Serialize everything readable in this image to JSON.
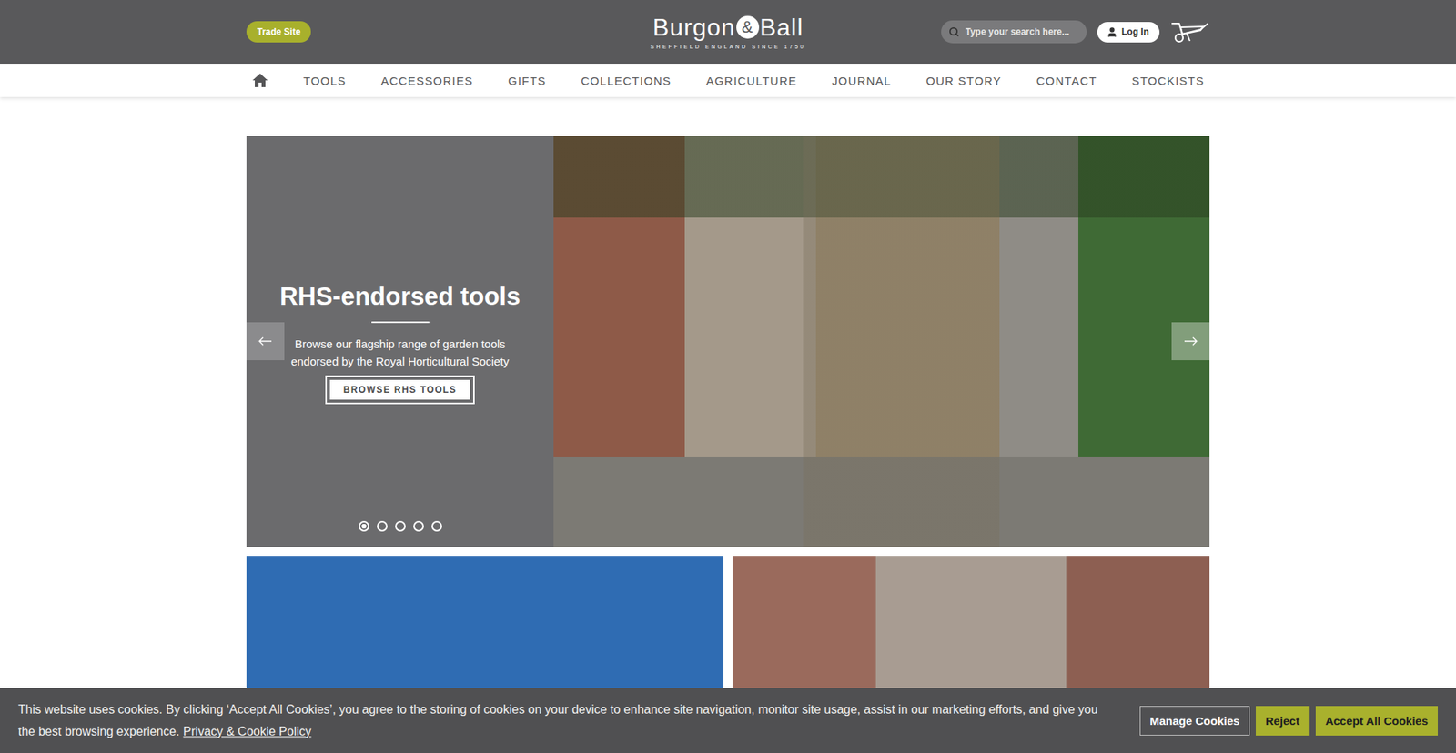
{
  "header": {
    "trade_site": "Trade Site",
    "logo": {
      "left": "Burgon",
      "ampersand": "&",
      "right": "Ball",
      "tagline": "SHEFFIELD ENGLAND SINCE 1750"
    },
    "search": {
      "placeholder": "Type your search here..."
    },
    "login": "Log In"
  },
  "nav": {
    "items": [
      {
        "label": "TOOLS"
      },
      {
        "label": "ACCESSORIES"
      },
      {
        "label": "GIFTS"
      },
      {
        "label": "COLLECTIONS"
      },
      {
        "label": "AGRICULTURE"
      },
      {
        "label": "JOURNAL"
      },
      {
        "label": "OUR STORY"
      },
      {
        "label": "CONTACT"
      },
      {
        "label": "STOCKISTS"
      }
    ]
  },
  "hero": {
    "title": "RHS-endorsed tools",
    "text": "Browse our flagship range of garden tools endorsed by the Royal Horticultural Society",
    "button": "BROWSE RHS TOOLS",
    "dots": [
      {
        "selected": true
      },
      {
        "selected": false
      },
      {
        "selected": false
      },
      {
        "selected": false
      },
      {
        "selected": false
      }
    ]
  },
  "cookie_banner": {
    "text": "This website uses cookies. By clicking ‘Accept All Cookies’, you agree to the storing of cookies on your device to enhance site navigation, monitor site usage, assist in our marketing efforts, and give you the best browsing experience.",
    "link": "Privacy & Cookie Policy",
    "buttons": [
      {
        "label": "Manage Cookies",
        "kind": "outline"
      },
      {
        "label": "Reject",
        "kind": "primary"
      },
      {
        "label": "Accept All Cookies",
        "kind": "primary"
      }
    ]
  }
}
